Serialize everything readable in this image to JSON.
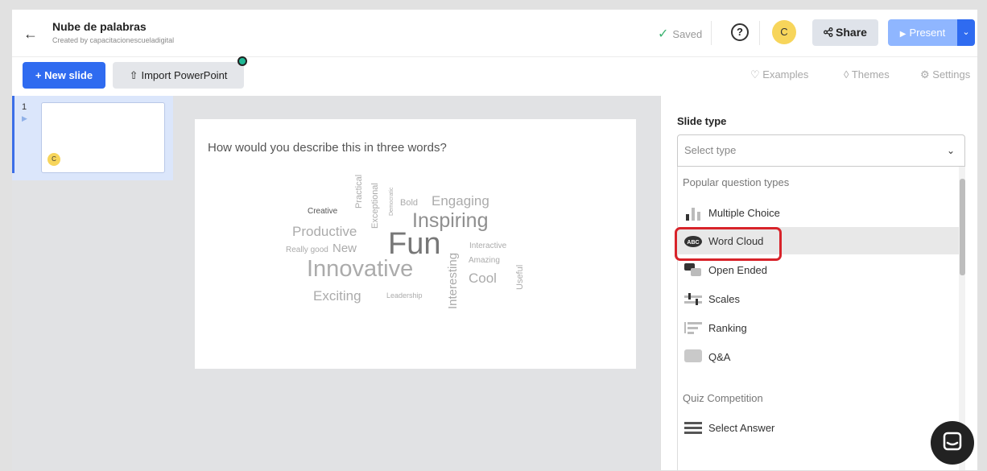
{
  "header": {
    "back_icon": "arrow-left-icon",
    "title": "Nube de palabras",
    "subtitle": "Created by capacitacionescueladigital",
    "saved_label": "Saved",
    "help_label": "?",
    "avatar_initial": "C",
    "share_label": "Share",
    "present_label": "Present"
  },
  "toolbar": {
    "new_slide_label": "+ New slide",
    "import_label": "Import PowerPoint",
    "examples_label": "Examples",
    "themes_label": "Themes",
    "settings_label": "Settings"
  },
  "slides": [
    {
      "number": "1",
      "avatar_initial": "C"
    }
  ],
  "slide": {
    "question": "How would you describe this in three words?",
    "words": [
      "Practical",
      "Exceptional",
      "Democratic",
      "Bold",
      "Engaging",
      "Creative",
      "Inspiring",
      "Productive",
      "Fun",
      "Interactive",
      "Really good",
      "New",
      "Interesting",
      "Amazing",
      "Useful",
      "Innovative",
      "Cool",
      "Exciting",
      "Leadership"
    ]
  },
  "panel": {
    "title": "Slide type",
    "select_placeholder": "Select type",
    "group_popular": "Popular question types",
    "options": [
      "Multiple Choice",
      "Word Cloud",
      "Open Ended",
      "Scales",
      "Ranking",
      "Q&A"
    ],
    "group_quiz": "Quiz Competition",
    "quiz_options": [
      "Select Answer"
    ],
    "selected": "Word Cloud"
  },
  "colors": {
    "accent": "#2f6bf0",
    "present": "#8fb6ff",
    "highlight": "#d8232a",
    "avatar": "#f7d55b",
    "saved_check": "#3cb371"
  }
}
